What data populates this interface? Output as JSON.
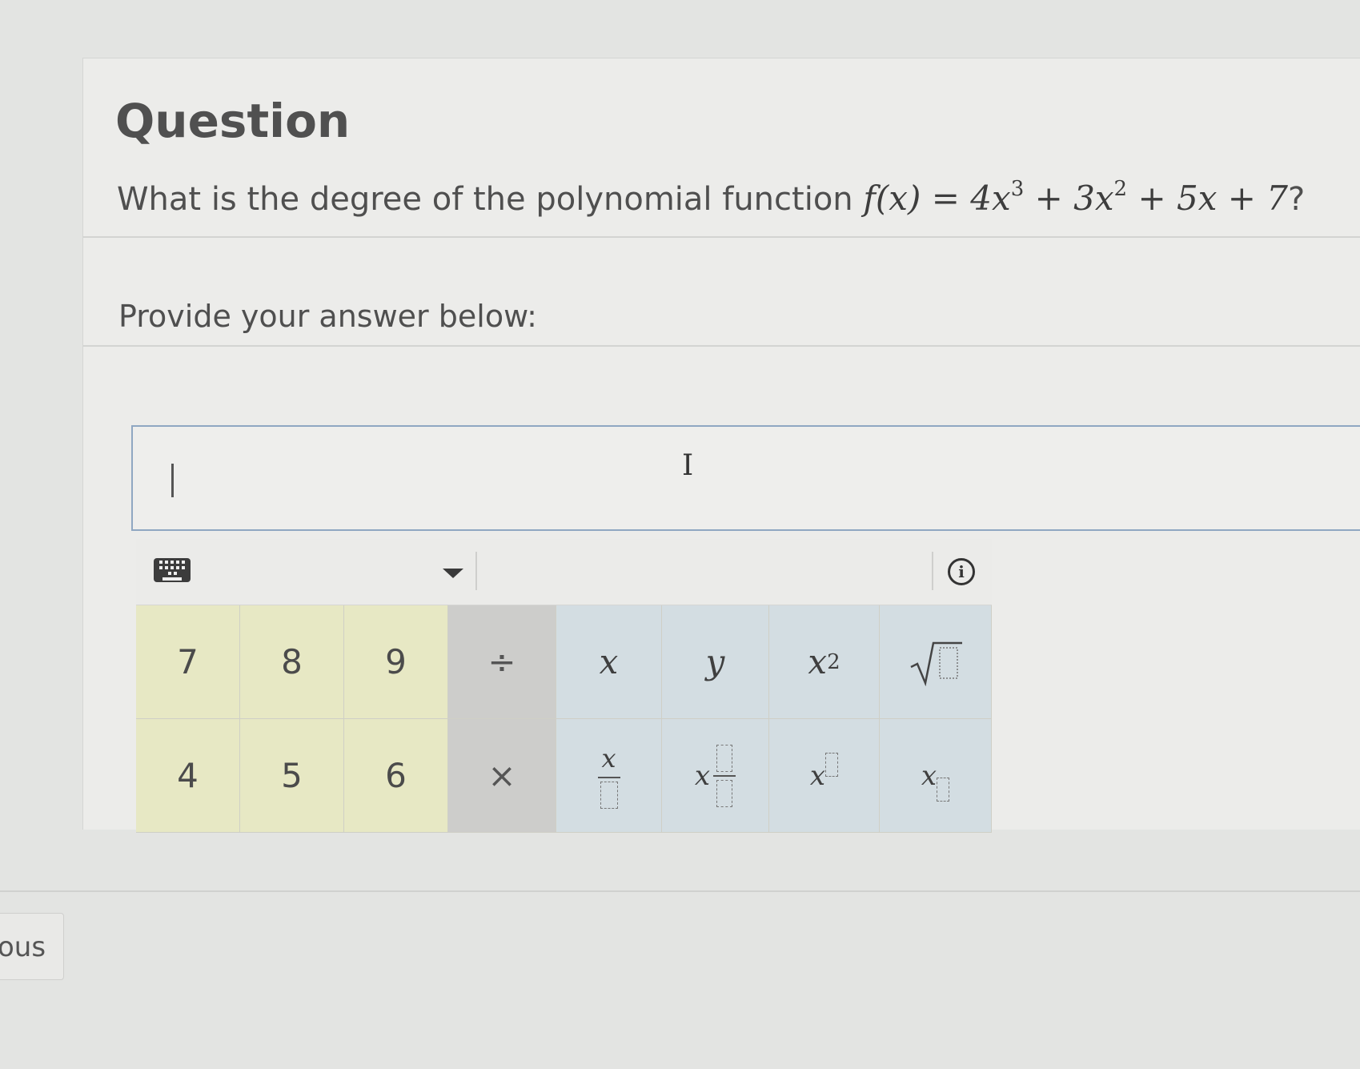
{
  "question": {
    "title": "Question",
    "text": "What is the degree of the polynomial function",
    "equation_lhs": "f(x) = 4x",
    "exp1": "3",
    "term2": " + 3x",
    "exp2": "2",
    "tail": " + 5x + 7",
    "end": "?"
  },
  "prompt": "Provide your answer below:",
  "answer": {
    "value": ""
  },
  "keypad": {
    "digits_row1": [
      "7",
      "8",
      "9"
    ],
    "digits_row2": [
      "4",
      "5",
      "6"
    ],
    "op_divide": "÷",
    "op_times": "×",
    "var_x": "x",
    "var_y": "y",
    "x_squared_base": "x",
    "x_squared_exp": "2",
    "frac_num": "x",
    "mixed_whole": "x",
    "power_base": "x",
    "subscript_base": "x",
    "colors": {
      "digits": "#e7e8c4",
      "operators": "#cdcdcb",
      "variables": "#d3dde2"
    },
    "icons": [
      "keyboard-icon",
      "dropdown-caret-icon",
      "info-icon",
      "sqrt-icon"
    ]
  },
  "side_tab": "ous"
}
